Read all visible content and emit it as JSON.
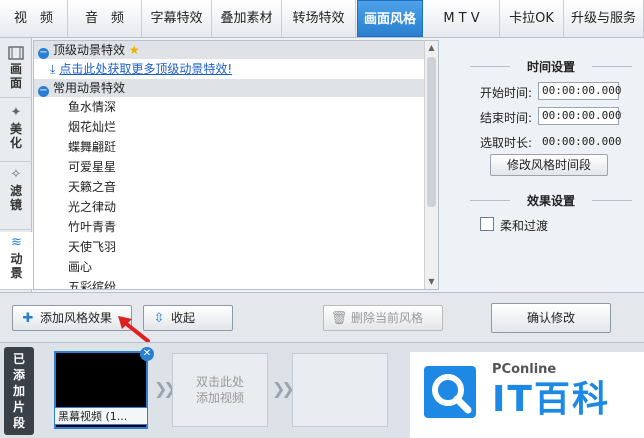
{
  "top_tabs": [
    {
      "label": "视　频"
    },
    {
      "label": "音　频"
    },
    {
      "label": "字幕特效"
    },
    {
      "label": "叠加素材"
    },
    {
      "label": "转场特效"
    },
    {
      "label": "画面风格"
    },
    {
      "label": "M T V"
    },
    {
      "label": "卡拉OK"
    },
    {
      "label": "升级与服务"
    }
  ],
  "active_tab": "画面风格",
  "side_tabs": [
    {
      "label": "画面",
      "icon": "film-icon"
    },
    {
      "label": "美化",
      "icon": "magic-wand-icon"
    },
    {
      "label": "滤镜",
      "icon": "filter-wand-icon"
    },
    {
      "label": "动景",
      "icon": "waves-icon"
    }
  ],
  "effects": {
    "group_top": "顶级动景特效",
    "download_link": "点击此处获取更多顶级动景特效!",
    "group_common": "常用动景特效",
    "items": [
      "鱼水情深",
      "烟花灿烂",
      "蝶舞翩跹",
      "可爱星星",
      "天籁之音",
      "光之律动",
      "竹叶青青",
      "天使飞羽",
      "画心",
      "五彩缤纷"
    ]
  },
  "time_settings": {
    "title": "时间设置",
    "start_label": "开始时间:",
    "start_value": "00:00:00.000",
    "end_label": "结束时间:",
    "end_value": "00:00:00.000",
    "selected_label": "选取时长:",
    "selected_value": "00:00:00.000",
    "modify_button": "修改风格时间段"
  },
  "effect_settings": {
    "title": "效果设置",
    "fade_label": "柔和过渡"
  },
  "actions": {
    "add_effect": "添加风格效果",
    "collapse": "收起",
    "delete_current": "删除当前风格",
    "confirm": "确认修改"
  },
  "timeline": {
    "side_label": "已添加片段",
    "clip_name": "黑幕视频 (1...",
    "empty_slot": "双击此处\n添加视频"
  },
  "watermark": {
    "brand": "PConline",
    "name": "IT百科"
  },
  "colors": {
    "accent": "#2a7fd0",
    "link": "#1a5fd0",
    "arrow": "#e02020"
  }
}
